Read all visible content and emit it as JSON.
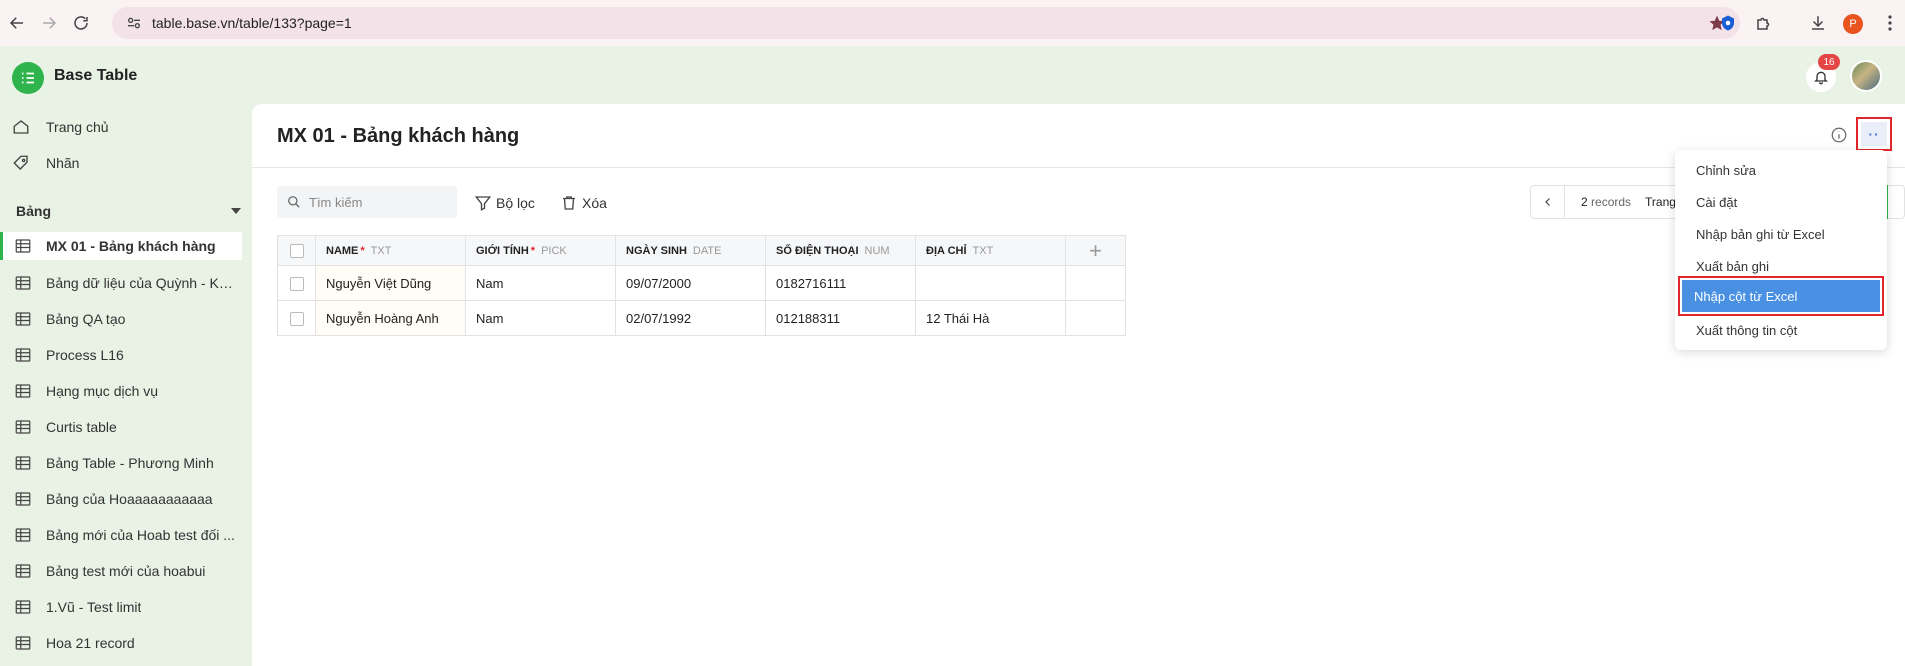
{
  "browser": {
    "url": "table.base.vn/table/133?page=1",
    "profile_initial": "P"
  },
  "app": {
    "title": "Base Table",
    "notification_count": "16"
  },
  "sidebar": {
    "links": [
      {
        "label": "Trang chủ",
        "icon": "home-icon"
      },
      {
        "label": "Nhãn",
        "icon": "tag-icon"
      }
    ],
    "section_title": "Bảng",
    "tables": [
      {
        "label": "MX 01 - Bảng khách hàng",
        "active": true
      },
      {
        "label": "Bảng dữ liệu của Quỳnh - KH..."
      },
      {
        "label": "Bảng QA tạo"
      },
      {
        "label": "Process L16"
      },
      {
        "label": "Hạng mục dịch vụ"
      },
      {
        "label": "Curtis table"
      },
      {
        "label": "Bảng Table - Phương Minh"
      },
      {
        "label": "Bảng của Hoaaaaaaaaaaa"
      },
      {
        "label": "Bảng mới của Hoab test đối ..."
      },
      {
        "label": "Bảng test mới của hoabui"
      },
      {
        "label": "1.Vũ - Test limit"
      },
      {
        "label": "Hoa 21 record"
      }
    ]
  },
  "page": {
    "title": "MX 01 - Bảng khách hàng",
    "more_label": "··"
  },
  "toolbar": {
    "search_placeholder": "Tìm kiếm",
    "filter_label": "Bộ lọc",
    "delete_label": "Xóa"
  },
  "pager": {
    "count_num": "2",
    "count_label": "records",
    "page_label": "Trang"
  },
  "table": {
    "columns": [
      {
        "name": "NAME",
        "required": "*",
        "type": "TXT"
      },
      {
        "name": "GIỚI TÍNH",
        "required": "*",
        "type": "PICK"
      },
      {
        "name": "NGÀY SINH",
        "required": "",
        "type": "DATE"
      },
      {
        "name": "SỐ ĐIỆN THOẠI",
        "required": "",
        "type": "NUM"
      },
      {
        "name": "ĐỊA CHỈ",
        "required": "",
        "type": "TXT"
      }
    ],
    "add_column": "+",
    "rows": [
      [
        "Nguyễn Việt Dũng",
        "Nam",
        "09/07/2000",
        "0182716111",
        ""
      ],
      [
        "Nguyễn Hoàng Anh",
        "Nam",
        "02/07/1992",
        "012188311",
        "12 Thái Hà"
      ]
    ]
  },
  "menu": {
    "items": [
      {
        "label": "Chỉnh sửa"
      },
      {
        "label": "Cài đặt"
      },
      {
        "label": "Nhập bản ghi từ Excel"
      },
      {
        "label": "Xuất bản ghi"
      },
      {
        "label": "Nhập cột từ Excel",
        "highlighted": true
      },
      {
        "label": "Xuất thông tin cột"
      }
    ]
  },
  "colors": {
    "brand_green": "#2fb34c",
    "sidebar_bg": "#e8f2e5",
    "highlight_blue": "#4a90e2",
    "annotation_red": "#e0252b"
  }
}
